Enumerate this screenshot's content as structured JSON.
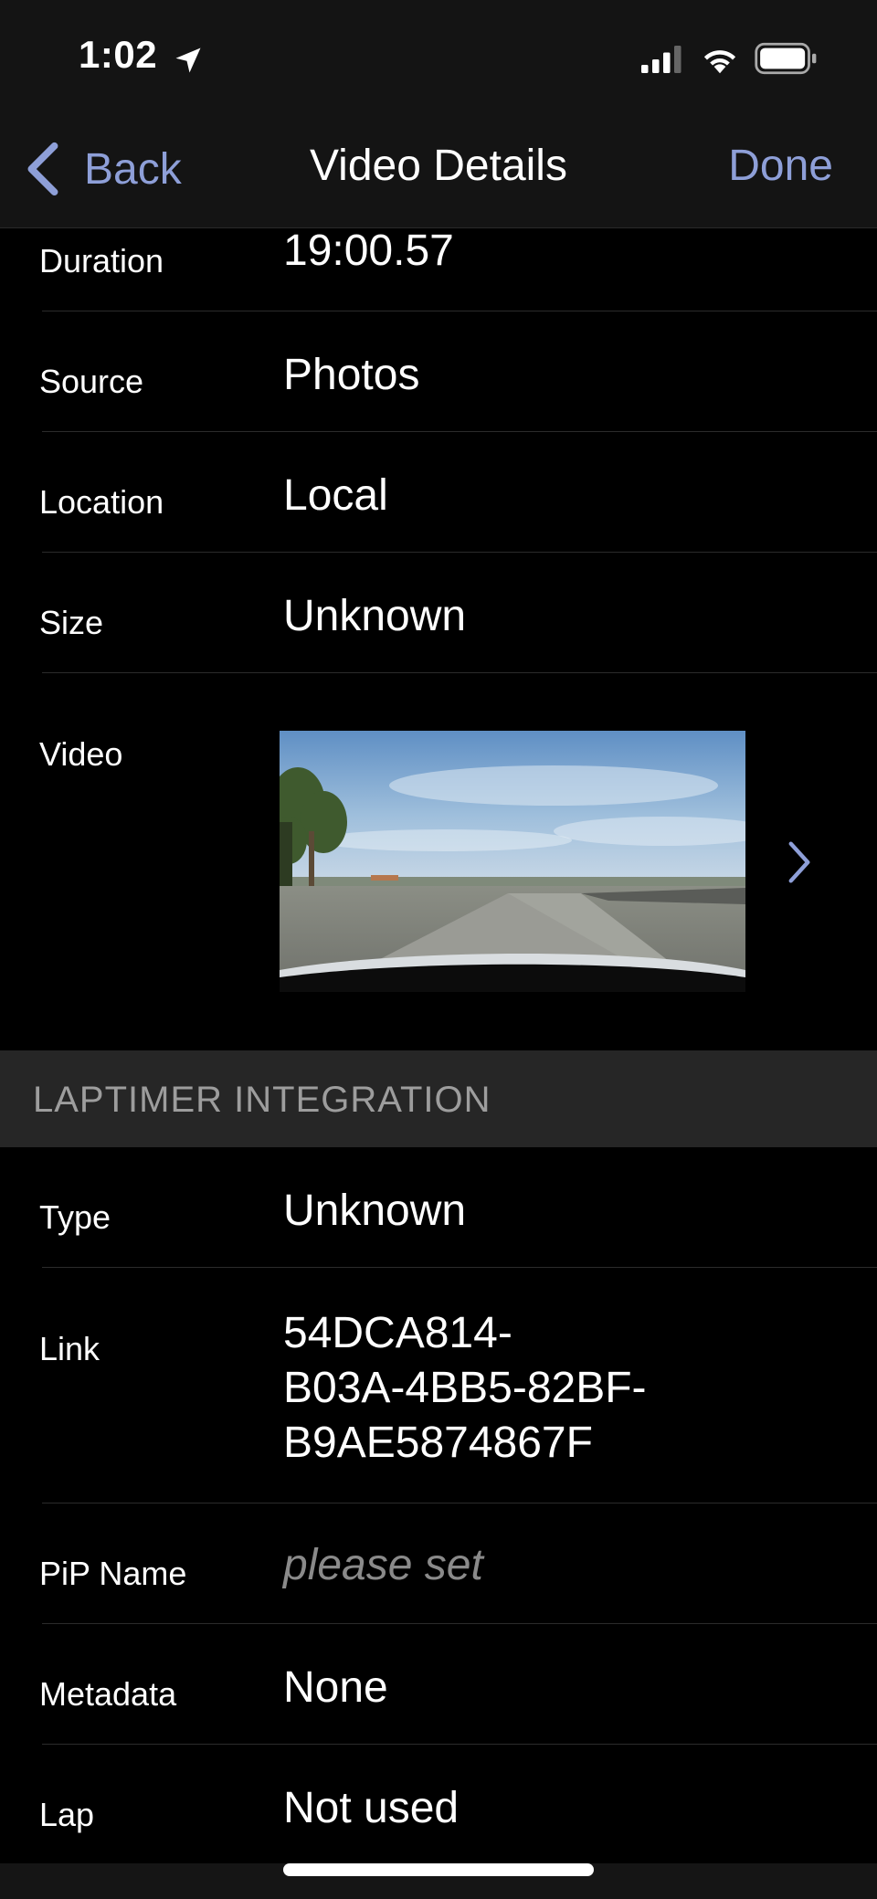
{
  "status_bar": {
    "time": "1:02"
  },
  "nav": {
    "back_label": "Back",
    "title": "Video Details",
    "done_label": "Done"
  },
  "details": [
    {
      "label": "Duration",
      "value": "19:00.57"
    },
    {
      "label": "Source",
      "value": "Photos"
    },
    {
      "label": "Location",
      "value": "Local"
    },
    {
      "label": "Size",
      "value": "Unknown"
    },
    {
      "label": "Video"
    }
  ],
  "section": {
    "title": "LAPTIMER INTEGRATION"
  },
  "integration": [
    {
      "label": "Type",
      "value": "Unknown"
    },
    {
      "label": "Link",
      "value_lines": [
        "54DCA814-",
        "B03A-4BB5-82BF-",
        "B9AE5874867F"
      ]
    },
    {
      "label": "PiP Name",
      "placeholder": "please set"
    },
    {
      "label": "Metadata",
      "value": "None"
    },
    {
      "label": "Lap",
      "value": "Not used"
    }
  ],
  "colors": {
    "accent": "#8e9fd8",
    "background": "#000000",
    "bar_background": "#141414",
    "section_background": "#262626",
    "placeholder": "#8a8a8a"
  },
  "icons": {
    "back": "chevron-left-icon",
    "disclosure": "chevron-right-icon",
    "status": [
      "location-arrow-icon",
      "signal-icon",
      "wifi-icon",
      "battery-icon"
    ]
  }
}
